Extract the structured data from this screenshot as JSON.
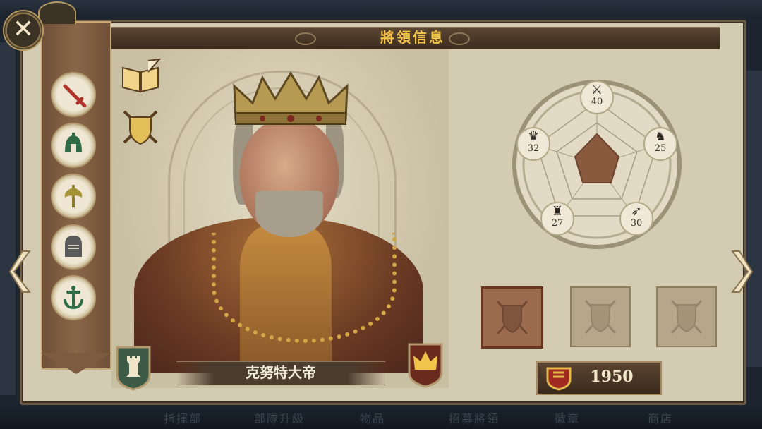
{
  "title": "將領信息",
  "general": {
    "name": "克努特大帝",
    "power": "1950"
  },
  "stats": [
    {
      "icon": "swords",
      "value": "40"
    },
    {
      "icon": "knight",
      "value": "25"
    },
    {
      "icon": "bow",
      "value": "30"
    },
    {
      "icon": "eagle",
      "value": "27"
    },
    {
      "icon": "crown",
      "value": "32"
    }
  ],
  "roles": [
    {
      "icon": "sword",
      "active": true
    },
    {
      "icon": "spartan-helmet",
      "active": false
    },
    {
      "icon": "axe",
      "active": false
    },
    {
      "icon": "knight-helmet",
      "active": false
    },
    {
      "icon": "anchor",
      "active": false
    }
  ],
  "background_tabs": [
    "指揮部",
    "部隊升級",
    "物品",
    "招募將領",
    "徽章",
    "商店"
  ],
  "colors": {
    "title_text": "#f6c44b",
    "panel": "#d4cbb3",
    "ribbon": "#7c5b40",
    "accent_gold": "#d2a545"
  }
}
